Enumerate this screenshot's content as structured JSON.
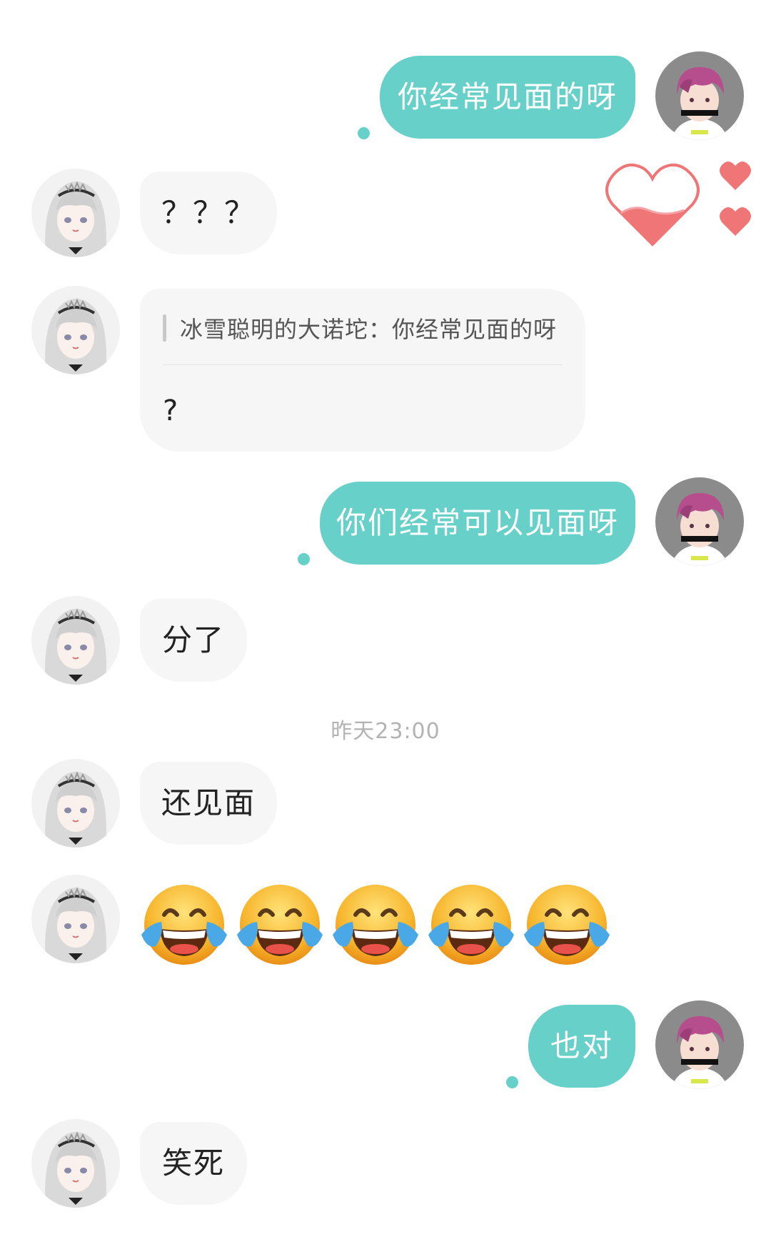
{
  "top_remnant_text": "",
  "timestamp": "昨天23:00",
  "messages": {
    "m1": "你经常见面的呀",
    "m2": "？？？",
    "m3_quote": "冰雪聪明的大诺坨：你经常见面的呀",
    "m3_reply": "?",
    "m4": "你们经常可以见面呀",
    "m5": "分了",
    "m6": "还见面",
    "m8": "也对",
    "m9": "笑死"
  },
  "emoji_row": [
    "face-with-tears-of-joy",
    "face-with-tears-of-joy",
    "face-with-tears-of-joy",
    "face-with-tears-of-joy",
    "face-with-tears-of-joy"
  ],
  "colors": {
    "sent_bubble": "#66d0c9",
    "received_bubble": "#f6f6f6",
    "heart": "#f07577"
  }
}
